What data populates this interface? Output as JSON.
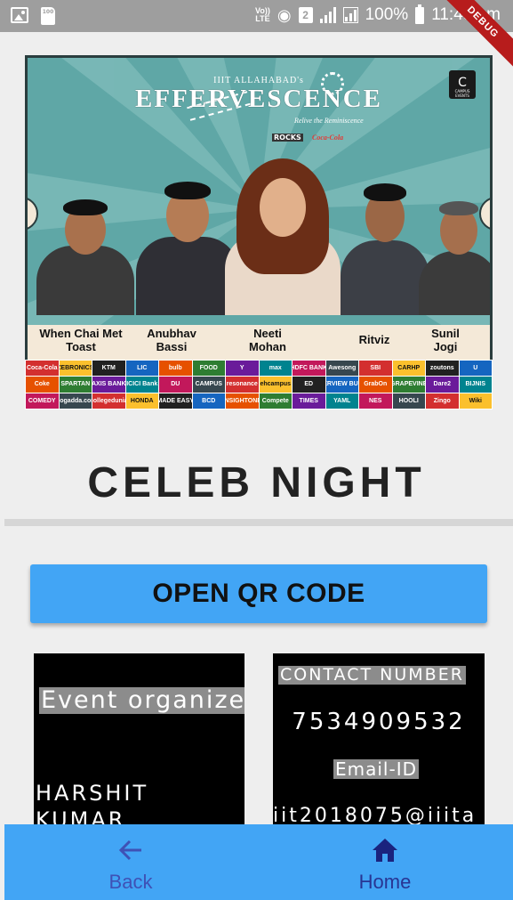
{
  "status_bar": {
    "volte_line1": "Vo))",
    "volte_line2": "LTE",
    "sim_badge": "2",
    "sd_label": "100",
    "battery": "100%",
    "time": "11:49 pm"
  },
  "debug_banner": "DEBUG",
  "poster": {
    "kicker": "IIIT ALLAHABAD's",
    "title": "EFFERVESCENCE",
    "tagline": "Relive the Reminiscence",
    "sponsor_1": "ROCKS",
    "sponsor_2": "Coca-Cola",
    "logo_glyph": "C",
    "logo_caption": "CAMPUS EVENTS",
    "celebrities": [
      {
        "name": "When Chai Met Toast"
      },
      {
        "name": "Anubhav Bassi"
      },
      {
        "name": "Neeti Mohan"
      },
      {
        "name": "Ritviz"
      },
      {
        "name": "Sunil Jogi"
      }
    ],
    "sponsors": [
      "Coca-Cola",
      "ZEBRONICS",
      "KTM",
      "LIC",
      "bulb",
      "FOOD",
      "Y",
      "max",
      "HDFC BANK",
      "Awesong",
      "SBI",
      "CARHP",
      "zoutons",
      "U",
      "Coke",
      "SPARTAN",
      "AXIS BANK",
      "ICICI Bank",
      "DU",
      "CAMPUS",
      "resonance",
      "ehcampus",
      "ED",
      "INTERVIEW BUDDY",
      "GrabOn",
      "GRAPEVINE",
      "Dare2",
      "BIJNIS",
      "COMEDY",
      "blogadda.com",
      "collegedunia",
      "HONDA",
      "MADE EASY",
      "BCD",
      "INSIGHTONE",
      "Compete",
      "TIMES",
      "YAML",
      "NES",
      "HOOLI",
      "Zingo",
      "Wiki"
    ]
  },
  "heading": "CELEB NIGHT",
  "qr_button_label": "OPEN QR CODE",
  "organizer_card": {
    "label": "Event organizer",
    "name": "HARSHIT KUMAR"
  },
  "contact_card": {
    "label": "CONTACT NUMBER",
    "number": "7534909532",
    "email_label": "Email-ID",
    "email": "iit2018075@iiita"
  },
  "bottom_nav": {
    "back_label": "Back",
    "home_label": "Home"
  },
  "colors": {
    "accent": "#42a5f5",
    "status_bar": "#9e9e9e",
    "poster_teal": "#5fa7a6",
    "name_band": "#f4e9d8",
    "debug_red": "#b71c1c"
  }
}
